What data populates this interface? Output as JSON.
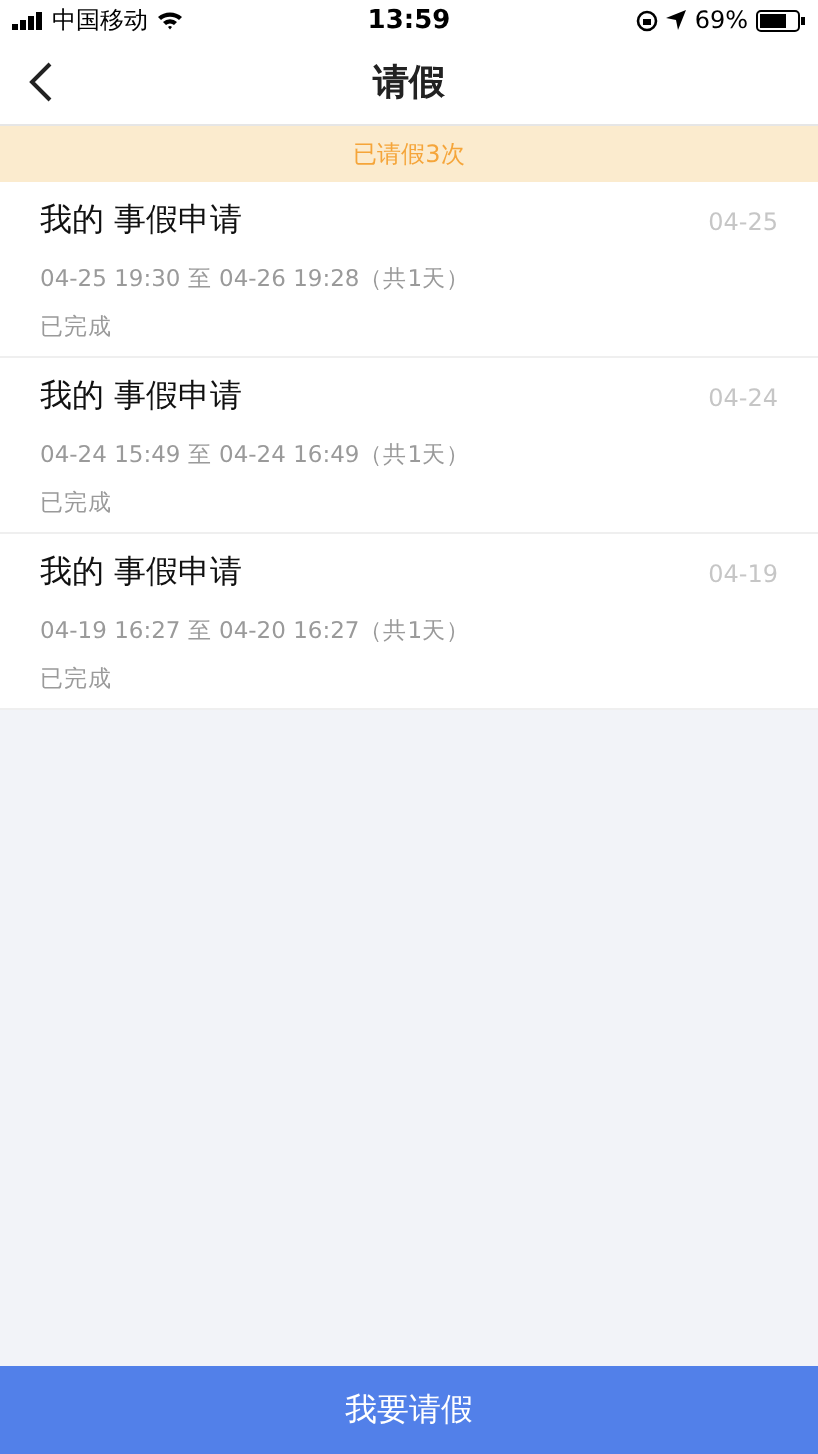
{
  "status_bar": {
    "carrier": "中国移动",
    "time": "13:59",
    "battery": "69%"
  },
  "nav": {
    "title": "请假"
  },
  "banner": "已请假3次",
  "requests": [
    {
      "title": "我的 事假申请",
      "date": "04-25",
      "period": "04-25 19:30 至 04-26 19:28（共1天）",
      "status": "已完成"
    },
    {
      "title": "我的 事假申请",
      "date": "04-24",
      "period": "04-24 15:49 至 04-24 16:49（共1天）",
      "status": "已完成"
    },
    {
      "title": "我的 事假申请",
      "date": "04-19",
      "period": "04-19 16:27 至 04-20 16:27（共1天）",
      "status": "已完成"
    }
  ],
  "action_button": "我要请假"
}
